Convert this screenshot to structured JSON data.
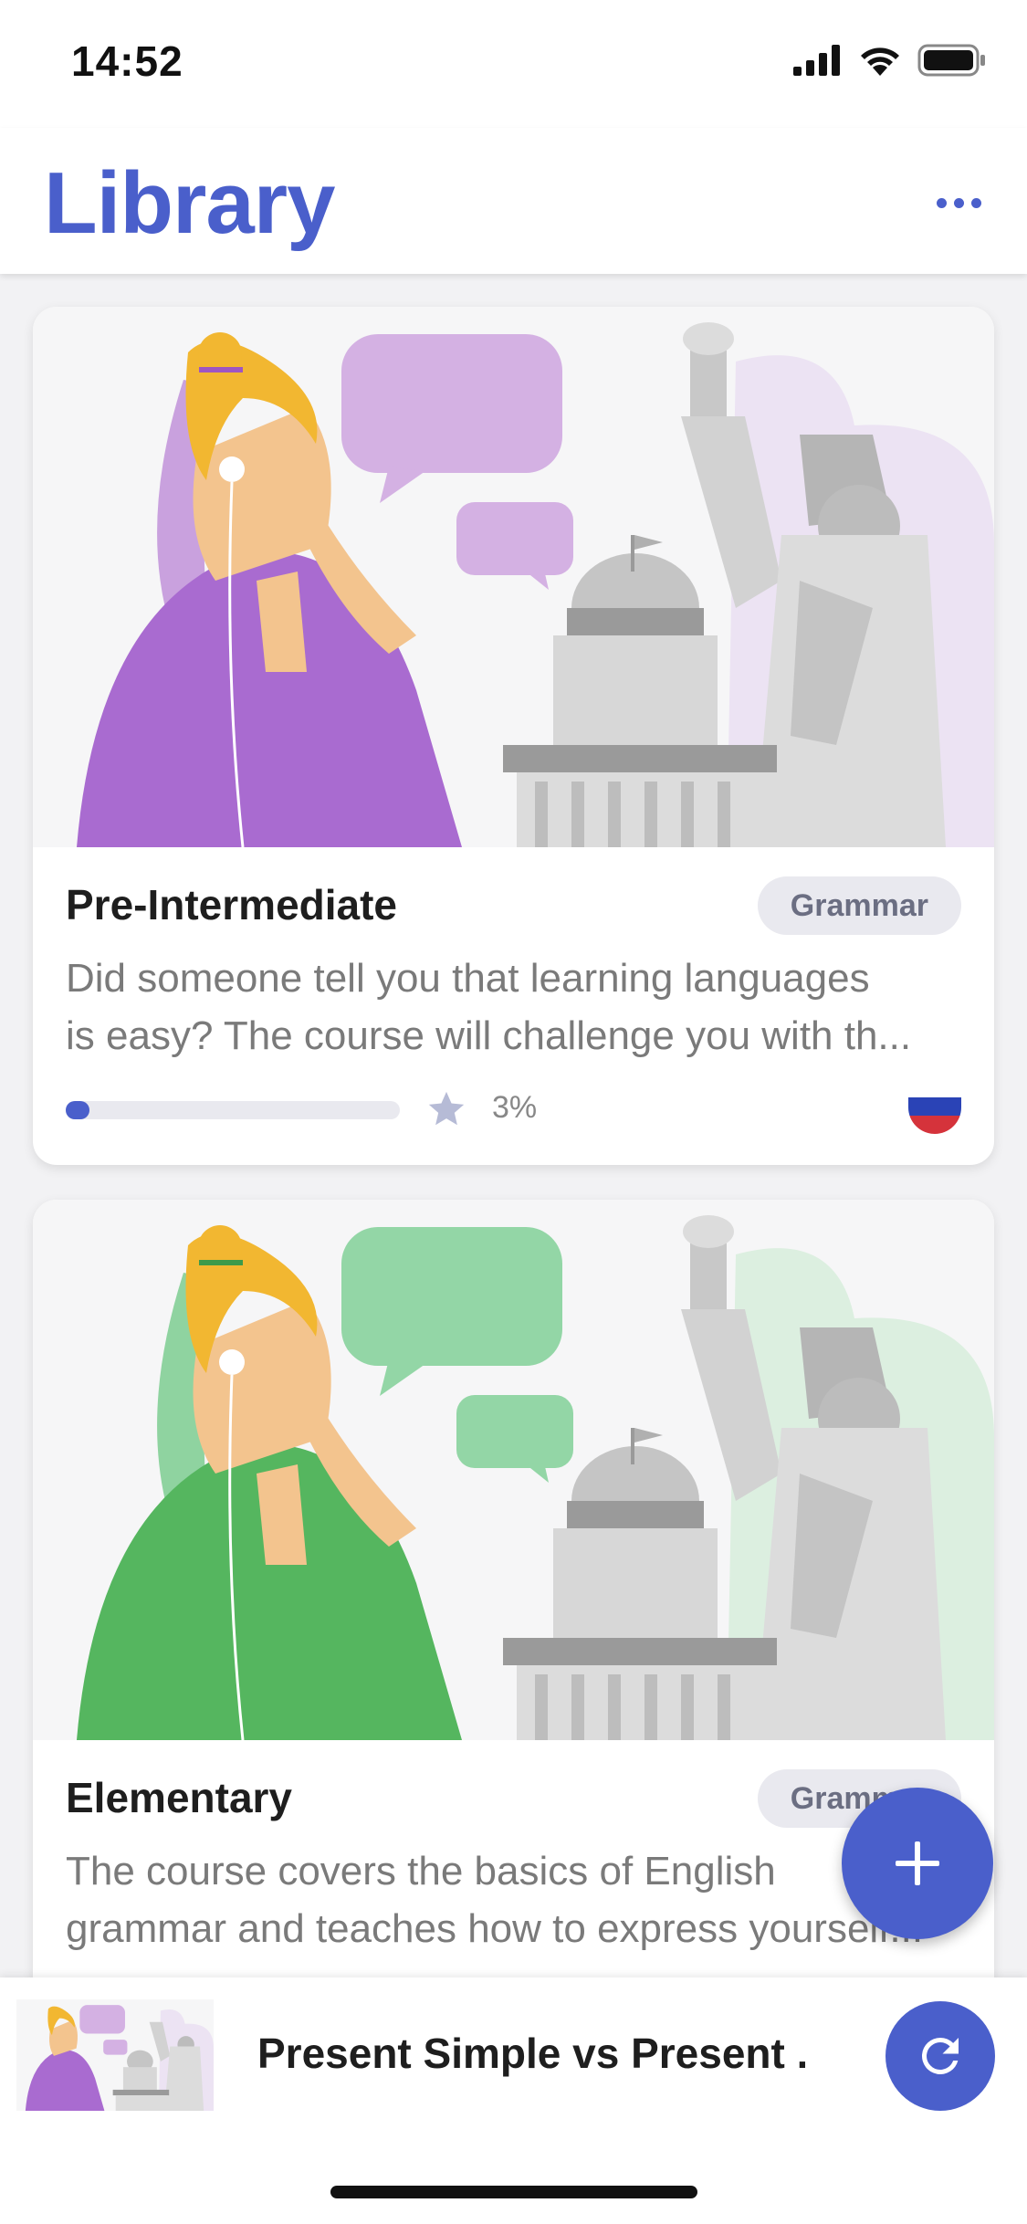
{
  "status_bar": {
    "time": "14:52",
    "icons": [
      "cellular-signal-icon",
      "wifi-icon",
      "battery-icon"
    ]
  },
  "header": {
    "title": "Library",
    "menu_icon": "more-horizontal-icon"
  },
  "courses": [
    {
      "title": "Pre-Intermediate",
      "tag": "Grammar",
      "description_lines": [
        "Did someone tell you that learning languages",
        "is easy? The course will challenge you with th..."
      ],
      "progress_percent": 3,
      "progress_label": "3%",
      "accent_color": "#a96bd0",
      "language_flag": "russian-flag-icon"
    },
    {
      "title": "Elementary",
      "tag": "Grammar",
      "description_lines": [
        "The course covers the basics of English",
        "grammar and teaches how to express yourself..."
      ],
      "accent_color": "#55b65f",
      "language_flag": "russian-flag-icon"
    }
  ],
  "fab": {
    "icon": "plus-icon"
  },
  "mini_player": {
    "title": "Present Simple vs Present ...",
    "action_icon": "replay-icon"
  },
  "colors": {
    "brand": "#4a5fcb",
    "tag_background": "#e9e9ef",
    "tag_text": "#6b6e82"
  }
}
